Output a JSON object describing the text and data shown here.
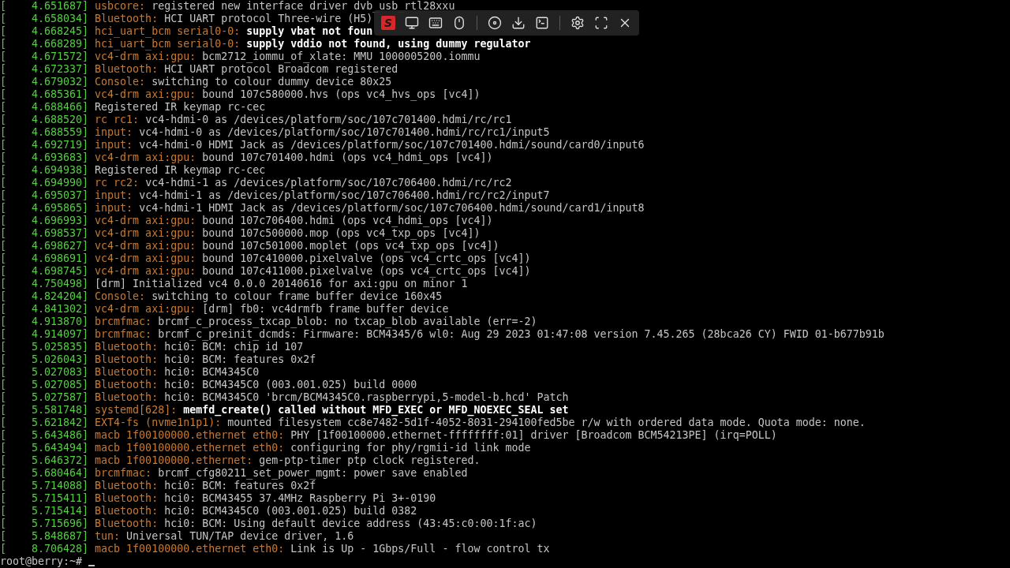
{
  "console": {
    "lines": [
      {
        "timestamp": "[    4.651687]",
        "source": "usbcore:",
        "message": "registered new interface driver dvb_usb_rtl28xxu",
        "bright": false
      },
      {
        "timestamp": "[    4.658034]",
        "source": "Bluetooth:",
        "message": "HCI UART protocol Three-wire (H5)",
        "bright": false
      },
      {
        "timestamp": "[    4.668245]",
        "source": "hci_uart_bcm serial0-0:",
        "message": "supply vbat not foun",
        "bright": true
      },
      {
        "timestamp": "[    4.668289]",
        "source": "hci_uart_bcm serial0-0:",
        "message": "supply vddio not found, using dummy regulator",
        "bright": true
      },
      {
        "timestamp": "[    4.671572]",
        "source": "vc4-drm axi:gpu:",
        "message": "bcm2712_iommu_of_xlate: MMU 1000005200.iommu",
        "bright": false
      },
      {
        "timestamp": "[    4.672337]",
        "source": "Bluetooth:",
        "message": "HCI UART protocol Broadcom registered",
        "bright": false
      },
      {
        "timestamp": "[    4.679032]",
        "source": "Console:",
        "message": "switching to colour dummy device 80x25",
        "bright": false
      },
      {
        "timestamp": "[    4.685361]",
        "source": "vc4-drm axi:gpu:",
        "message": "bound 107c580000.hvs (ops vc4_hvs_ops [vc4])",
        "bright": false
      },
      {
        "timestamp": "[    4.688466]",
        "message": "Registered IR keymap rc-cec",
        "bright": false
      },
      {
        "timestamp": "[    4.688520]",
        "source": "rc rc1:",
        "message": "vc4-hdmi-0 as /devices/platform/soc/107c701400.hdmi/rc/rc1",
        "bright": false
      },
      {
        "timestamp": "[    4.688559]",
        "source": "input:",
        "message": "vc4-hdmi-0 as /devices/platform/soc/107c701400.hdmi/rc/rc1/input5",
        "bright": false
      },
      {
        "timestamp": "[    4.692719]",
        "source": "input:",
        "message": "vc4-hdmi-0 HDMI Jack as /devices/platform/soc/107c701400.hdmi/sound/card0/input6",
        "bright": false
      },
      {
        "timestamp": "[    4.693683]",
        "source": "vc4-drm axi:gpu:",
        "message": "bound 107c701400.hdmi (ops vc4_hdmi_ops [vc4])",
        "bright": false
      },
      {
        "timestamp": "[    4.694938]",
        "message": "Registered IR keymap rc-cec",
        "bright": false
      },
      {
        "timestamp": "[    4.694990]",
        "source": "rc rc2:",
        "message": "vc4-hdmi-1 as /devices/platform/soc/107c706400.hdmi/rc/rc2",
        "bright": false
      },
      {
        "timestamp": "[    4.695037]",
        "source": "input:",
        "message": "vc4-hdmi-1 as /devices/platform/soc/107c706400.hdmi/rc/rc2/input7",
        "bright": false
      },
      {
        "timestamp": "[    4.695865]",
        "source": "input:",
        "message": "vc4-hdmi-1 HDMI Jack as /devices/platform/soc/107c706400.hdmi/sound/card1/input8",
        "bright": false
      },
      {
        "timestamp": "[    4.696993]",
        "source": "vc4-drm axi:gpu:",
        "message": "bound 107c706400.hdmi (ops vc4_hdmi_ops [vc4])",
        "bright": false
      },
      {
        "timestamp": "[    4.698537]",
        "source": "vc4-drm axi:gpu:",
        "message": "bound 107c500000.mop (ops vc4_txp_ops [vc4])",
        "bright": false
      },
      {
        "timestamp": "[    4.698627]",
        "source": "vc4-drm axi:gpu:",
        "message": "bound 107c501000.moplet (ops vc4_txp_ops [vc4])",
        "bright": false
      },
      {
        "timestamp": "[    4.698691]",
        "source": "vc4-drm axi:gpu:",
        "message": "bound 107c410000.pixelvalve (ops vc4_crtc_ops [vc4])",
        "bright": false
      },
      {
        "timestamp": "[    4.698745]",
        "source": "vc4-drm axi:gpu:",
        "message": "bound 107c411000.pixelvalve (ops vc4_crtc_ops [vc4])",
        "bright": false
      },
      {
        "timestamp": "[    4.750498]",
        "message": "[drm] Initialized vc4 0.0.0 20140616 for axi:gpu on minor 1",
        "bright": false
      },
      {
        "timestamp": "[    4.824204]",
        "source": "Console:",
        "message": "switching to colour frame buffer device 160x45",
        "bright": false
      },
      {
        "timestamp": "[    4.841302]",
        "source": "vc4-drm axi:gpu:",
        "message": "[drm] fb0: vc4drmfb frame buffer device",
        "bright": false
      },
      {
        "timestamp": "[    4.913870]",
        "source": "brcmfmac:",
        "message": "brcmf_c_process_txcap_blob: no txcap_blob available (err=-2)",
        "bright": false
      },
      {
        "timestamp": "[    4.914097]",
        "source": "brcmfmac:",
        "message": "brcmf_c_preinit_dcmds: Firmware: BCM4345/6 wl0: Aug 29 2023 01:47:08 version 7.45.265 (28bca26 CY) FWID 01-b677b91b",
        "bright": false
      },
      {
        "timestamp": "[    5.025835]",
        "source": "Bluetooth:",
        "message": "hci0: BCM: chip id 107",
        "bright": false
      },
      {
        "timestamp": "[    5.026043]",
        "source": "Bluetooth:",
        "message": "hci0: BCM: features 0x2f",
        "bright": false
      },
      {
        "timestamp": "[    5.027083]",
        "source": "Bluetooth:",
        "message": "hci0: BCM4345C0",
        "bright": false
      },
      {
        "timestamp": "[    5.027085]",
        "source": "Bluetooth:",
        "message": "hci0: BCM4345C0 (003.001.025) build 0000",
        "bright": false
      },
      {
        "timestamp": "[    5.027587]",
        "source": "Bluetooth:",
        "message": "hci0: BCM4345C0 'brcm/BCM4345C0.raspberrypi,5-model-b.hcd' Patch",
        "bright": false
      },
      {
        "timestamp": "[    5.581748]",
        "source": "systemd[628]:",
        "message": "memfd_create() called without MFD_EXEC or MFD_NOEXEC_SEAL set",
        "bright": true
      },
      {
        "timestamp": "[    5.621842]",
        "source": "EXT4-fs (nvme1n1p1):",
        "message": "mounted filesystem cc8e7482-5d1f-4052-8031-294100fed5be r/w with ordered data mode. Quota mode: none.",
        "bright": false
      },
      {
        "timestamp": "[    5.643486]",
        "source": "macb 1f00100000.ethernet eth0:",
        "message": "PHY [1f00100000.ethernet-ffffffff:01] driver [Broadcom BCM54213PE] (irq=POLL)",
        "bright": false
      },
      {
        "timestamp": "[    5.643494]",
        "source": "macb 1f00100000.ethernet eth0:",
        "message": "configuring for phy/rgmii-id link mode",
        "bright": false
      },
      {
        "timestamp": "[    5.646372]",
        "source": "macb 1f00100000.ethernet:",
        "message": "gem-ptp-timer ptp clock registered.",
        "bright": false
      },
      {
        "timestamp": "[    5.680464]",
        "source": "brcmfmac:",
        "message": "brcmf_cfg80211_set_power_mgmt: power save enabled",
        "bright": false
      },
      {
        "timestamp": "[    5.714088]",
        "source": "Bluetooth:",
        "message": "hci0: BCM: features 0x2f",
        "bright": false
      },
      {
        "timestamp": "[    5.715411]",
        "source": "Bluetooth:",
        "message": "hci0: BCM43455 37.4MHz Raspberry Pi 3+-0190",
        "bright": false
      },
      {
        "timestamp": "[    5.715414]",
        "source": "Bluetooth:",
        "message": "hci0: BCM4345C0 (003.001.025) build 0382",
        "bright": false
      },
      {
        "timestamp": "[    5.715696]",
        "source": "Bluetooth:",
        "message": "hci0: BCM: Using default device address (43:45:c0:00:1f:ac)",
        "bright": false
      },
      {
        "timestamp": "[    5.848687]",
        "source": "tun:",
        "message": "Universal TUN/TAP device driver, 1.6",
        "bright": false
      },
      {
        "timestamp": "[    8.706428]",
        "source": "macb 1f00100000.ethernet eth0:",
        "message": "Link is Up - 1Gbps/Full - flow control tx",
        "bright": false
      }
    ],
    "prompt": "root@berry:~#",
    "cursor": true
  },
  "toolbar": {
    "items": [
      {
        "kind": "logo",
        "text": "S"
      },
      {
        "kind": "monitor"
      },
      {
        "kind": "keyboard"
      },
      {
        "kind": "mouse"
      },
      {
        "kind": "separator"
      },
      {
        "kind": "disc"
      },
      {
        "kind": "download"
      },
      {
        "kind": "terminal"
      },
      {
        "kind": "separator"
      },
      {
        "kind": "settings"
      },
      {
        "kind": "fullscreen"
      },
      {
        "kind": "close"
      }
    ]
  }
}
